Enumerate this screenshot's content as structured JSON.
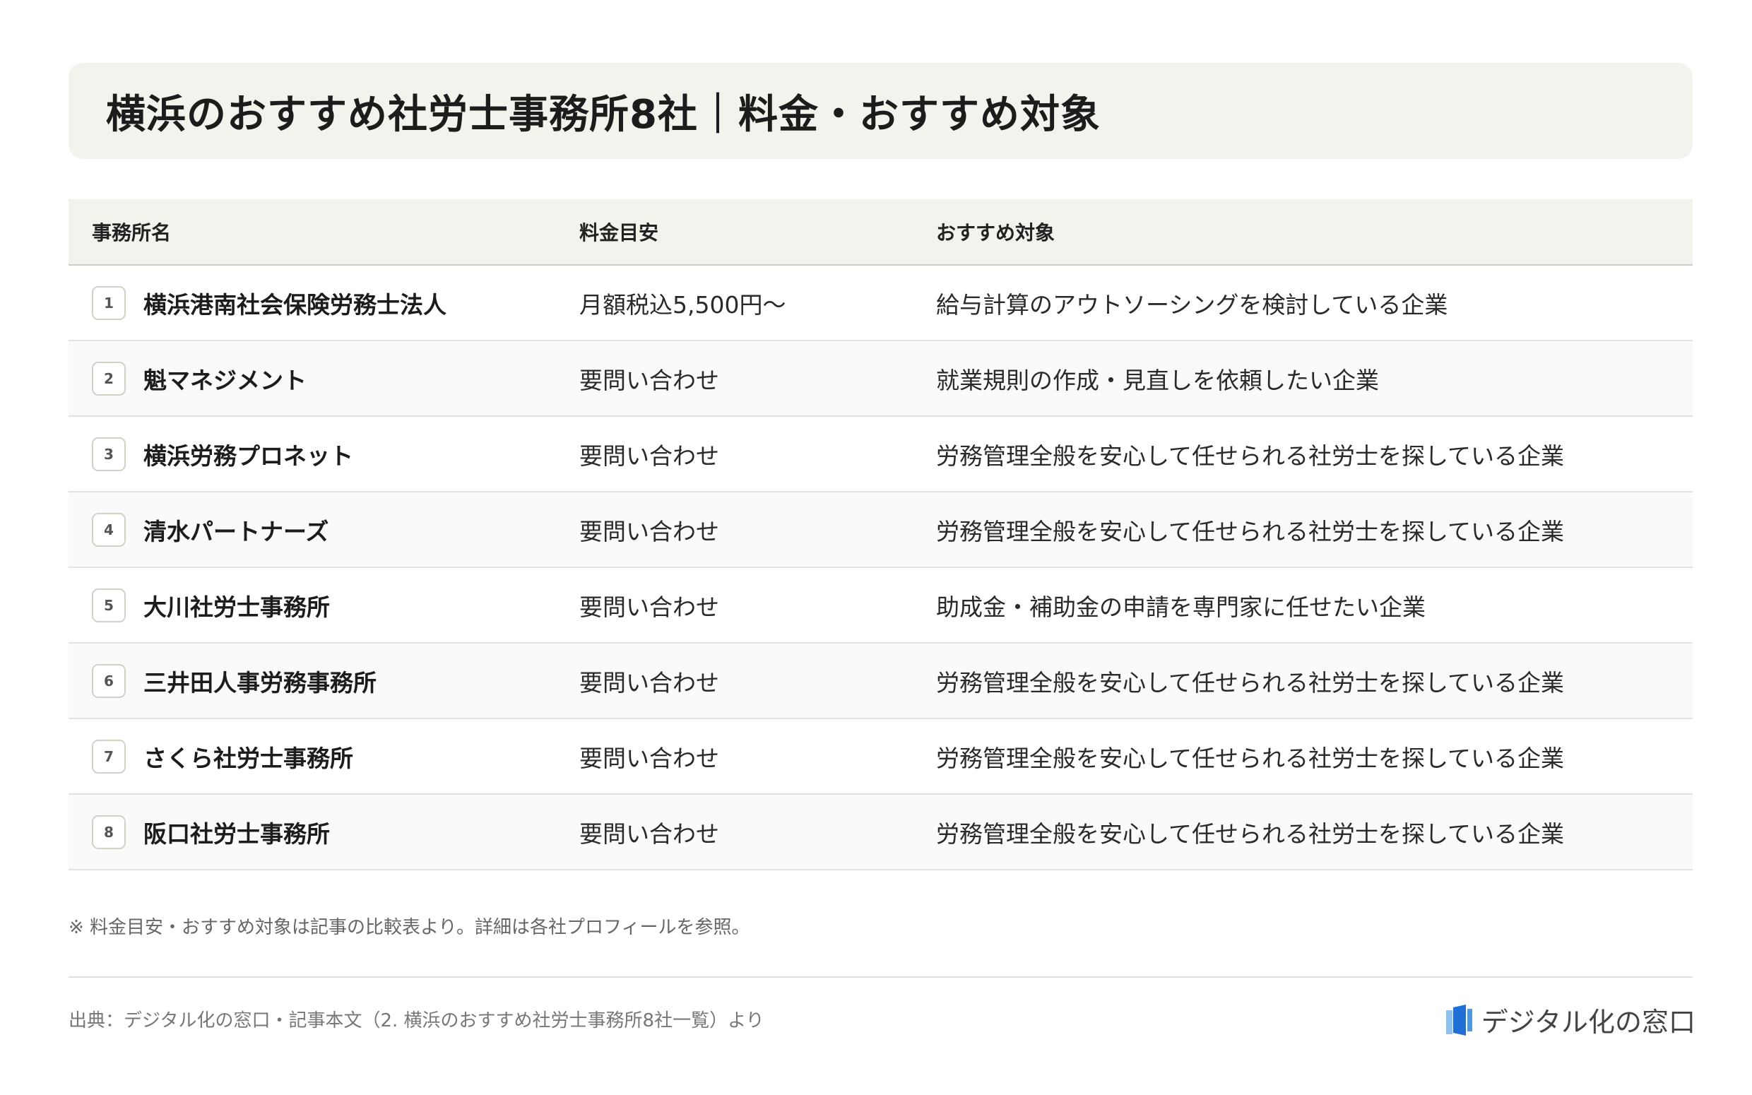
{
  "title": "横浜のおすすめ社労士事務所8社｜料金・おすすめ対象",
  "table": {
    "headers": {
      "name": "事務所名",
      "fee": "料金目安",
      "target": "おすすめ対象"
    },
    "rows": [
      {
        "num": "1",
        "name": "横浜港南社会保険労務士法人",
        "fee": "月額税込5,500円〜",
        "target": "給与計算のアウトソーシングを検討している企業"
      },
      {
        "num": "2",
        "name": "魁マネジメント",
        "fee": "要問い合わせ",
        "target": "就業規則の作成・見直しを依頼したい企業"
      },
      {
        "num": "3",
        "name": "横浜労務プロネット",
        "fee": "要問い合わせ",
        "target": "労務管理全般を安心して任せられる社労士を探している企業"
      },
      {
        "num": "4",
        "name": "清水パートナーズ",
        "fee": "要問い合わせ",
        "target": "労務管理全般を安心して任せられる社労士を探している企業"
      },
      {
        "num": "5",
        "name": "大川社労士事務所",
        "fee": "要問い合わせ",
        "target": "助成金・補助金の申請を専門家に任せたい企業"
      },
      {
        "num": "6",
        "name": "三井田人事労務事務所",
        "fee": "要問い合わせ",
        "target": "労務管理全般を安心して任せられる社労士を探している企業"
      },
      {
        "num": "7",
        "name": "さくら社労士事務所",
        "fee": "要問い合わせ",
        "target": "労務管理全般を安心して任せられる社労士を探している企業"
      },
      {
        "num": "8",
        "name": "阪口社労士事務所",
        "fee": "要問い合わせ",
        "target": "労務管理全般を安心して任せられる社労士を探している企業"
      }
    ]
  },
  "note": "※ 料金目安・おすすめ対象は記事の比較表より。詳細は各社プロフィールを参照。",
  "source": "出典：デジタル化の窓口・記事本文（2. 横浜のおすすめ社労士事務所8社一覧）より",
  "logo": {
    "text": "デジタル化の窓口",
    "icon": "document-logo-icon",
    "accent": "#1f6fd6"
  }
}
